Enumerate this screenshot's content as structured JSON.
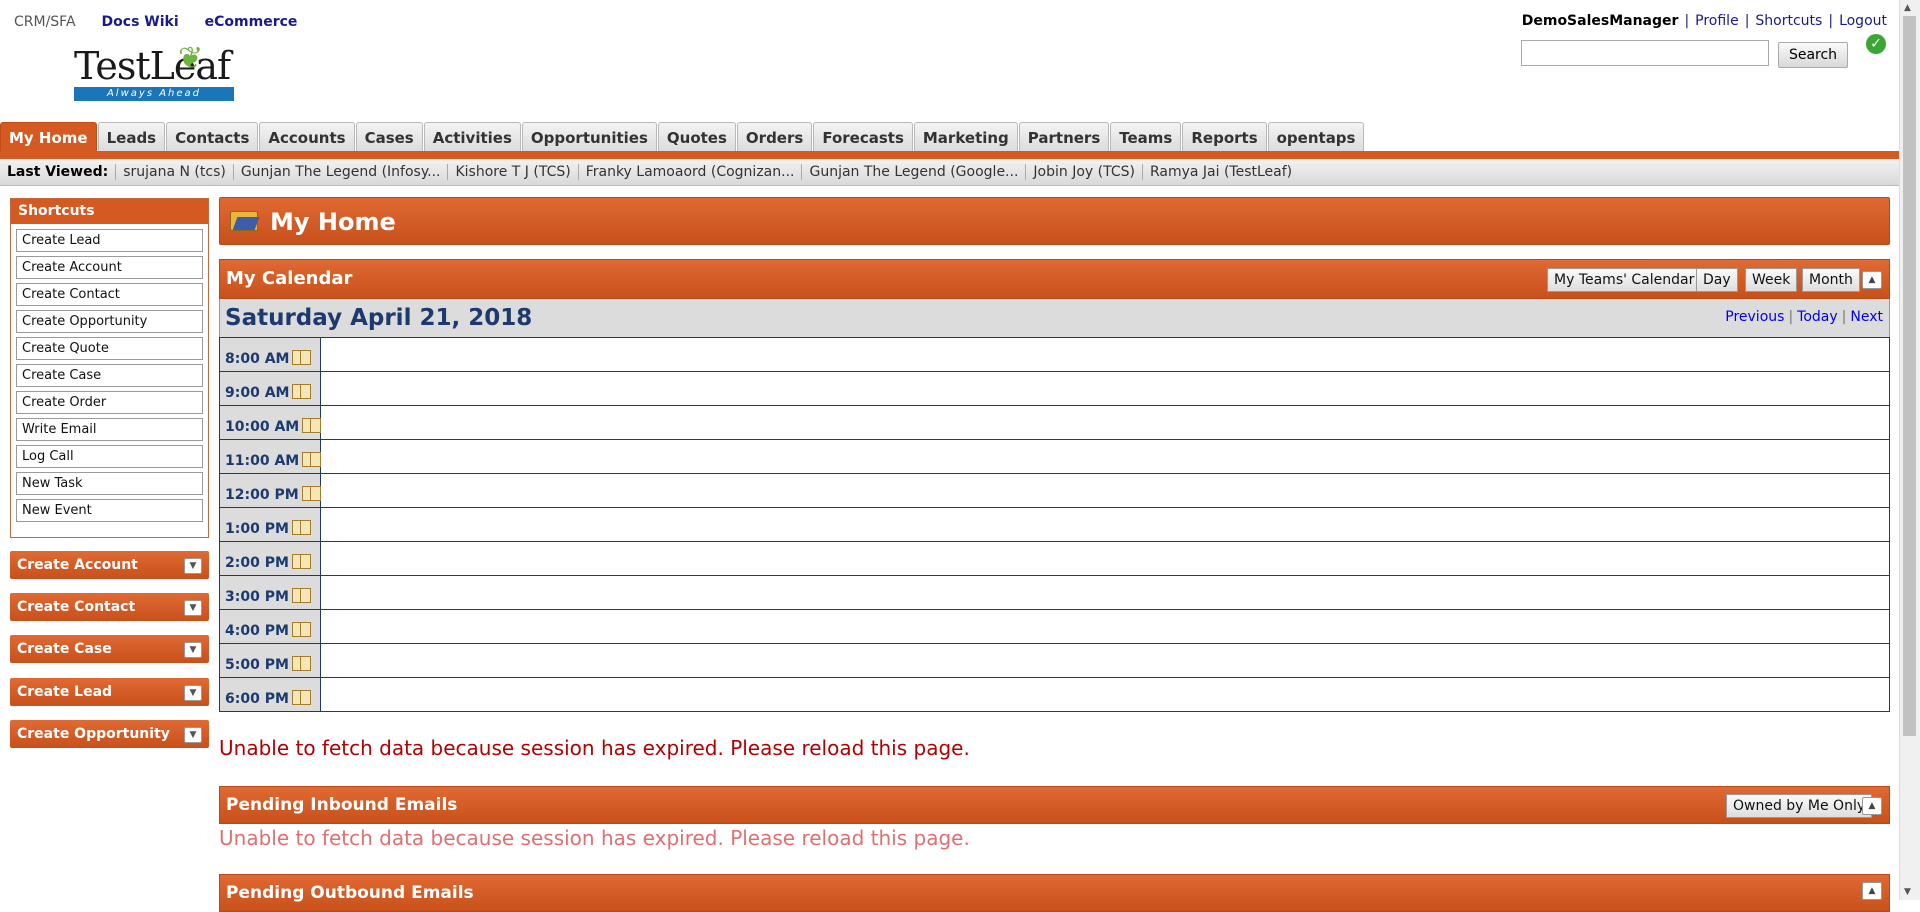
{
  "header": {
    "app_name": "CRM/SFA",
    "links": [
      "Docs Wiki",
      "eCommerce"
    ],
    "logo_text": "TestLeaf",
    "logo_tagline": "Always Ahead",
    "user": "DemoSalesManager",
    "user_links": [
      "Profile",
      "Shortcuts",
      "Logout"
    ],
    "search_button": "Search",
    "search_value": ""
  },
  "tabs": [
    "My Home",
    "Leads",
    "Contacts",
    "Accounts",
    "Cases",
    "Activities",
    "Opportunities",
    "Quotes",
    "Orders",
    "Forecasts",
    "Marketing",
    "Partners",
    "Teams",
    "Reports",
    "opentaps"
  ],
  "last_viewed": {
    "label": "Last Viewed:",
    "items": [
      "srujana N (tcs)",
      "Gunjan The Legend (Infosy...",
      "Kishore T J (TCS)",
      "Franky Lamoaord (Cognizan...",
      "Gunjan The Legend (Google...",
      "Jobin Joy (TCS)",
      "Ramya Jai (TestLeaf)"
    ]
  },
  "sidebar": {
    "shortcuts_title": "Shortcuts",
    "shortcuts": [
      "Create Lead",
      "Create Account",
      "Create Contact",
      "Create Opportunity",
      "Create Quote",
      "Create Case",
      "Create Order",
      "Write Email",
      "Log Call",
      "New Task",
      "New Event"
    ],
    "sections": [
      "Create Account",
      "Create Contact",
      "Create Case",
      "Create Lead",
      "Create Opportunity"
    ]
  },
  "main": {
    "title": "My Home",
    "calendar": {
      "title": "My Calendar",
      "buttons": [
        "My Teams' Calendar",
        "Day",
        "Week",
        "Month"
      ],
      "date": "Saturday April 21, 2018",
      "nav": [
        "Previous",
        "Today",
        "Next"
      ],
      "times": [
        "8:00 AM",
        "9:00 AM",
        "10:00 AM",
        "11:00 AM",
        "12:00 PM",
        "1:00 PM",
        "2:00 PM",
        "3:00 PM",
        "4:00 PM",
        "5:00 PM",
        "6:00 PM"
      ]
    },
    "error_message": "Unable to fetch data because session has expired. Please reload this page.",
    "pending_inbound": {
      "title": "Pending Inbound Emails",
      "button": "Owned by Me Only",
      "error": "Unable to fetch data because session has expired. Please reload this page."
    },
    "pending_outbound": {
      "title": "Pending Outbound Emails"
    }
  },
  "colors": {
    "accent": "#d45a21",
    "calendar_text": "#1c3a6e",
    "error": "#b30000"
  }
}
